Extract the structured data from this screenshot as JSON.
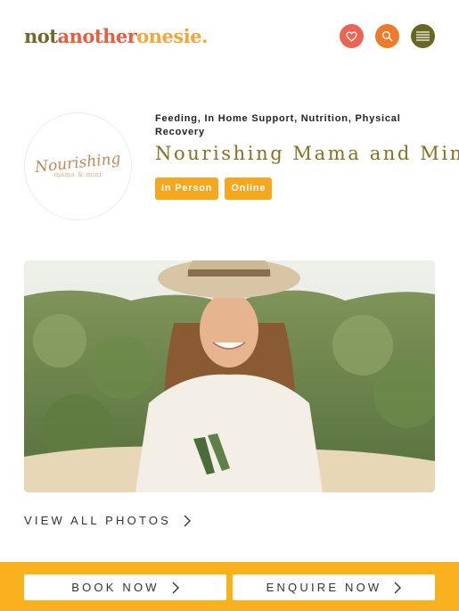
{
  "header": {
    "logo_parts": [
      "not",
      "another",
      "onesie."
    ],
    "favourites_icon": "heart-icon",
    "search_icon": "search-icon",
    "menu_icon": "hamburger-menu-icon"
  },
  "provider": {
    "logo_script": "Nourishing",
    "logo_sub": "mama & mini",
    "categories": "Feeding, In Home Support, Nutrition, Physical Recovery",
    "name": "Nourishing Mama and Mini",
    "tags": [
      "In Person",
      "Online"
    ]
  },
  "gallery": {
    "view_all_label": "VIEW ALL PHOTOS"
  },
  "actions": {
    "book_label": "BOOK NOW",
    "enquire_label": "ENQUIRE NOW"
  },
  "colors": {
    "accent_orange": "#f9b11d",
    "tag_bg": "#f7a71e",
    "name_gold": "#8a6f1f",
    "heart_btn": "#ee6454",
    "search_btn": "#ef7a2c",
    "menu_btn": "#6a6623"
  }
}
